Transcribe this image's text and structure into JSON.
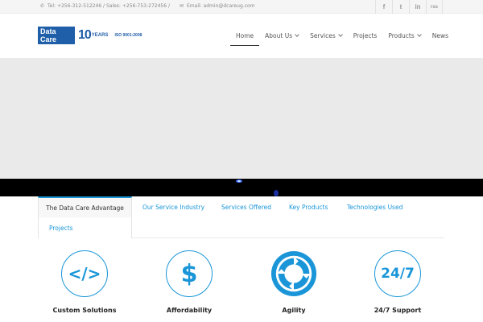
{
  "topbar": {
    "phone_icon": "phone-icon",
    "contact_text": "Tel: +256-312-512246 / Sales: +256-753-272456  /",
    "email_icon": "envelope-icon",
    "email_text": "Email: admin@dcareug.com",
    "socials": [
      {
        "name": "facebook-icon",
        "glyph": "f"
      },
      {
        "name": "twitter-icon",
        "glyph": "t"
      },
      {
        "name": "linkedin-icon",
        "glyph": "in"
      },
      {
        "name": "rss-icon",
        "glyph": "rss"
      }
    ]
  },
  "header": {
    "logo_line1": "Data",
    "logo_line2": "Care",
    "years_num": "10",
    "years_label": "YEARS",
    "iso": "ISO 9001:2008"
  },
  "nav": {
    "home": "Home",
    "about": "About Us",
    "services": "Services",
    "projects": "Projects",
    "products": "Products",
    "news": "News"
  },
  "tabs": {
    "advantage": "The Data Care Advantage",
    "industry": "Our Service Industry",
    "offered": "Services Offered",
    "key_products": "Key Products",
    "technologies": "Technologies Used",
    "projects": "Projects"
  },
  "features": [
    {
      "title": "Custom Solutions",
      "icon": "code-icon",
      "glyph": "</>"
    },
    {
      "title": "Affordability",
      "icon": "dollar-icon",
      "glyph": "$"
    },
    {
      "title": "Agility",
      "icon": "refresh-cycle-icon",
      "glyph": ""
    },
    {
      "title": "24/7 Support",
      "icon": "support-24-7-icon",
      "glyph": "24/7"
    }
  ],
  "colors": {
    "accent": "#1a96d8",
    "brand": "#1f5ea8"
  }
}
